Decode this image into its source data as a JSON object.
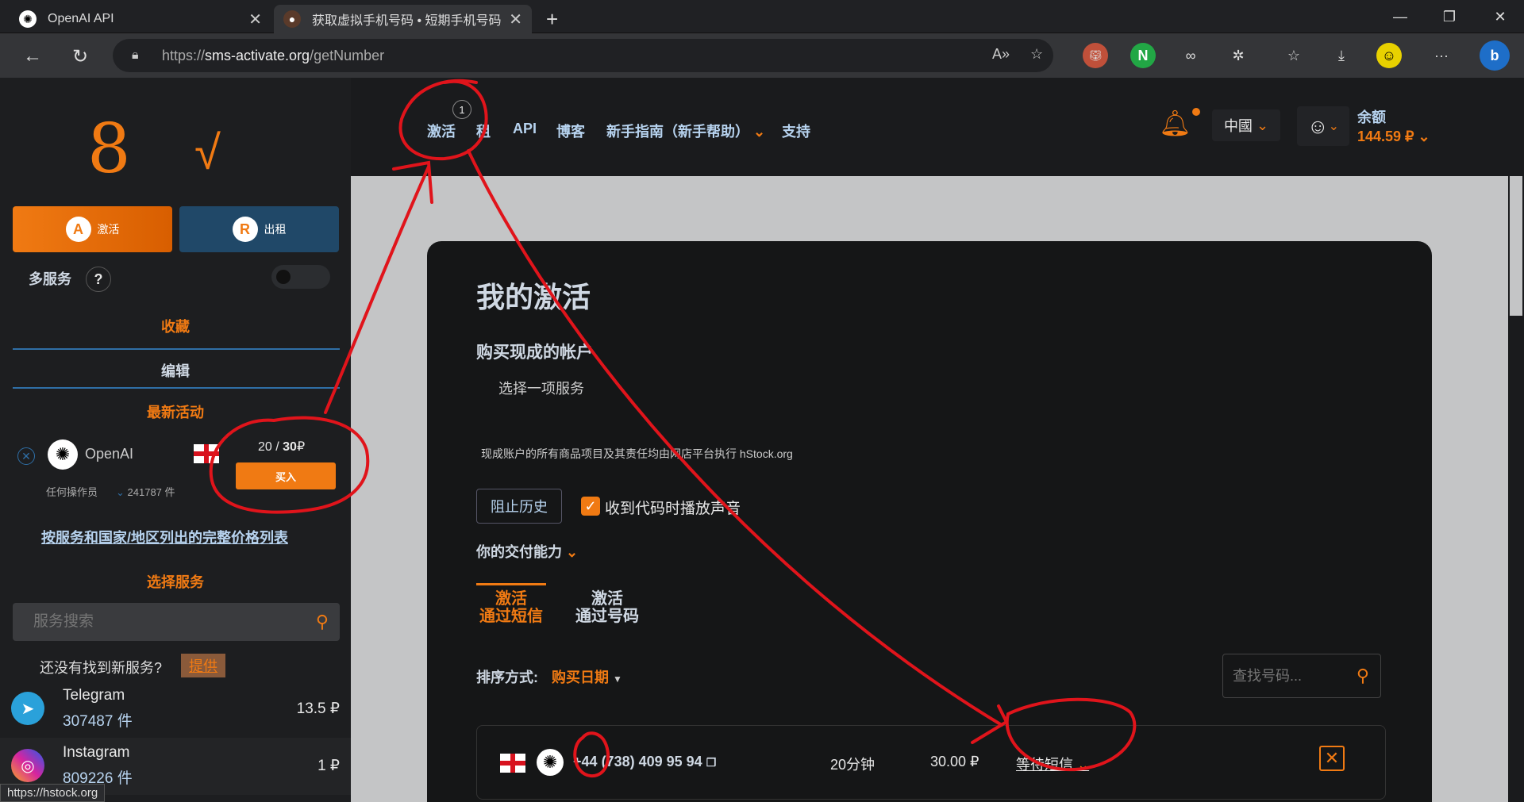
{
  "browser": {
    "tabs": [
      {
        "title": "OpenAI API",
        "active": false
      },
      {
        "title": "获取虚拟手机号码 • 短期手机号码",
        "active": true
      }
    ],
    "new_tab": "+",
    "url_prefix": "https://",
    "url_host": "sms-activate.org",
    "url_path": "/getNumber",
    "status_url": "https://hstock.org"
  },
  "sidebar": {
    "activate_label": "激活",
    "rent_label": "出租",
    "multi_service": "多服务",
    "help": "?",
    "favorites": "收藏",
    "edit": "编辑",
    "recent_activity": "最新活动",
    "recent": {
      "service": "OpenAI",
      "price_used": "20",
      "price_total": "30",
      "currency": "₽",
      "buy": "买入",
      "operator": "任何操作员",
      "count": "241787 件"
    },
    "price_list_link": "按服务和国家/地区列出的完整价格列表",
    "select_service": "选择服务",
    "search_placeholder": "服务搜索",
    "not_found": "还没有找到新服务?",
    "suggest": "提供",
    "services": [
      {
        "name": "Telegram",
        "count": "307487",
        "unit": "件",
        "price": "13.5 ₽"
      },
      {
        "name": "Instagram",
        "count": "809226",
        "unit": "件",
        "price": "1 ₽"
      }
    ]
  },
  "topnav": {
    "items": [
      "激活",
      "租",
      "API",
      "博客",
      "新手指南（新手帮助）",
      "支持"
    ],
    "badge": "1",
    "country": "中國",
    "balance_label": "余额",
    "balance_value": "144.59 ₽"
  },
  "main": {
    "title": "我的激活",
    "buy_accounts": "购买现成的帐户",
    "choose_service": "选择一项服务",
    "note": "现成账户的所有商品项目及其责任均由网店平台执行 hStock.org",
    "block_history": "阻止历史",
    "sound_label": "收到代码时播放声音",
    "sound_checked": true,
    "delivery": "你的交付能力",
    "tabs": [
      {
        "line1": "激活",
        "line2": "通过短信",
        "active": true
      },
      {
        "line1": "激活",
        "line2": "通过号码",
        "active": false
      }
    ],
    "sort_label": "排序方式:",
    "sort_value": "购买日期",
    "find_placeholder": "查找号码...",
    "activation": {
      "phone_code": "+44",
      "phone_rest": "(738) 409 95 94",
      "time": "20分钟",
      "price": "30.00 ₽",
      "status": "等待短信"
    }
  },
  "colors": {
    "accent": "#f07a13",
    "nav_text": "#b7d3ef",
    "annotation": "#e0141b"
  }
}
